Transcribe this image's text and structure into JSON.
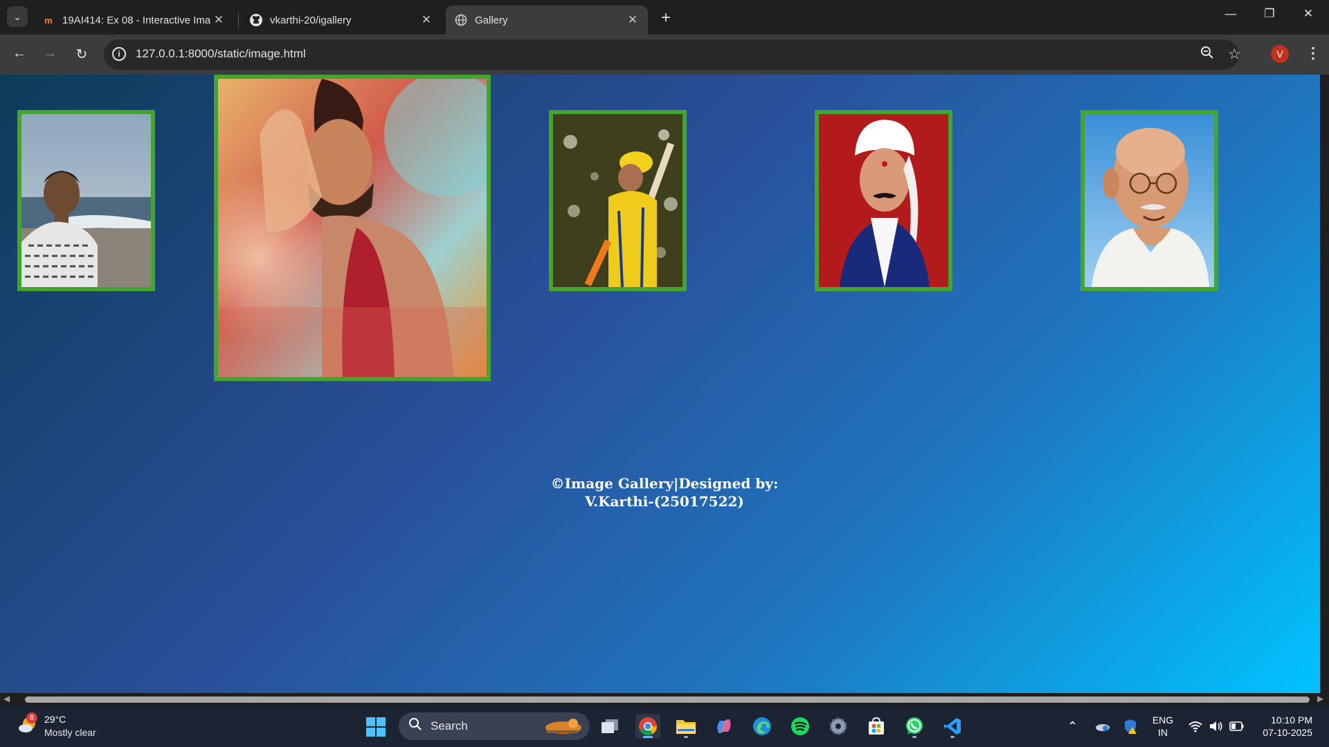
{
  "browser": {
    "tabs": [
      {
        "title": "19AI414: Ex 08 - Interactive Ima",
        "favicon": "moodle-icon",
        "active": false
      },
      {
        "title": "vkarthi-20/igallery",
        "favicon": "github-icon",
        "active": false
      },
      {
        "title": "Gallery",
        "favicon": "globe-icon",
        "active": true
      }
    ],
    "url": "127.0.0.1:8000/static/image.html",
    "profile_initial": "V"
  },
  "page": {
    "background_colors": [
      "#0e3b58",
      "#2a4e98",
      "#00c3ff"
    ],
    "frame_color": "#45a32f",
    "gallery": [
      {
        "subject": "man-selfie-at-beach"
      },
      {
        "subject": "actor-poster-painted"
      },
      {
        "subject": "cricketer-yellow-jersey"
      },
      {
        "subject": "poet-white-turban-portrait"
      },
      {
        "subject": "gandhi-portrait"
      }
    ],
    "footer_line1": "©Image Gallery|Designed by:",
    "footer_line2": "V.Karthi-(25017522)"
  },
  "taskbar": {
    "weather_badge": "8",
    "temperature": "29°C",
    "condition": "Mostly clear",
    "search_label": "Search",
    "language_line1": "ENG",
    "language_line2": "IN",
    "time": "10:10 PM",
    "date": "07-10-2025"
  }
}
